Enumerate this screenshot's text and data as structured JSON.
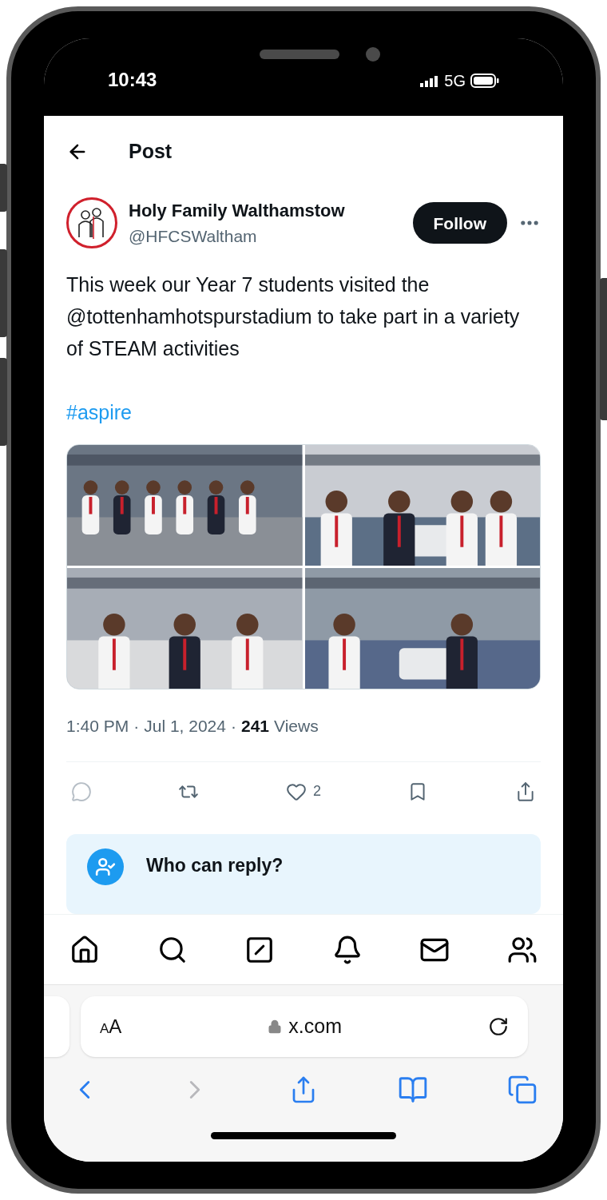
{
  "status_bar": {
    "time": "10:43",
    "network": "5G"
  },
  "header": {
    "title": "Post"
  },
  "author": {
    "name": "Holy Family Walthamstow",
    "handle": "@HFCSWaltham",
    "follow_label": "Follow"
  },
  "post": {
    "text": "This week our Year 7 students visited the @tottenhamhotspurstadium to take part in a variety of STEAM activities",
    "hashtag": "#aspire",
    "time": "1:40 PM",
    "separator": "·",
    "date": "Jul 1, 2024",
    "views_count": "241",
    "views_label": "Views"
  },
  "actions": [
    {
      "kind": "reply"
    },
    {
      "kind": "repost"
    },
    {
      "kind": "like",
      "count": "2"
    },
    {
      "kind": "bookmark"
    },
    {
      "kind": "share"
    }
  ],
  "reply_notice": {
    "title": "Who can reply?"
  },
  "tab_bar": [
    {
      "kind": "home"
    },
    {
      "kind": "search"
    },
    {
      "kind": "grok"
    },
    {
      "kind": "notifications"
    },
    {
      "kind": "messages"
    },
    {
      "kind": "communities"
    }
  ],
  "browser": {
    "text_size_label": "AA",
    "url": "x.com",
    "toolbar": [
      {
        "kind": "back",
        "disabled": false
      },
      {
        "kind": "forward",
        "disabled": true
      },
      {
        "kind": "share"
      },
      {
        "kind": "bookmarks"
      },
      {
        "kind": "tabs"
      }
    ]
  }
}
